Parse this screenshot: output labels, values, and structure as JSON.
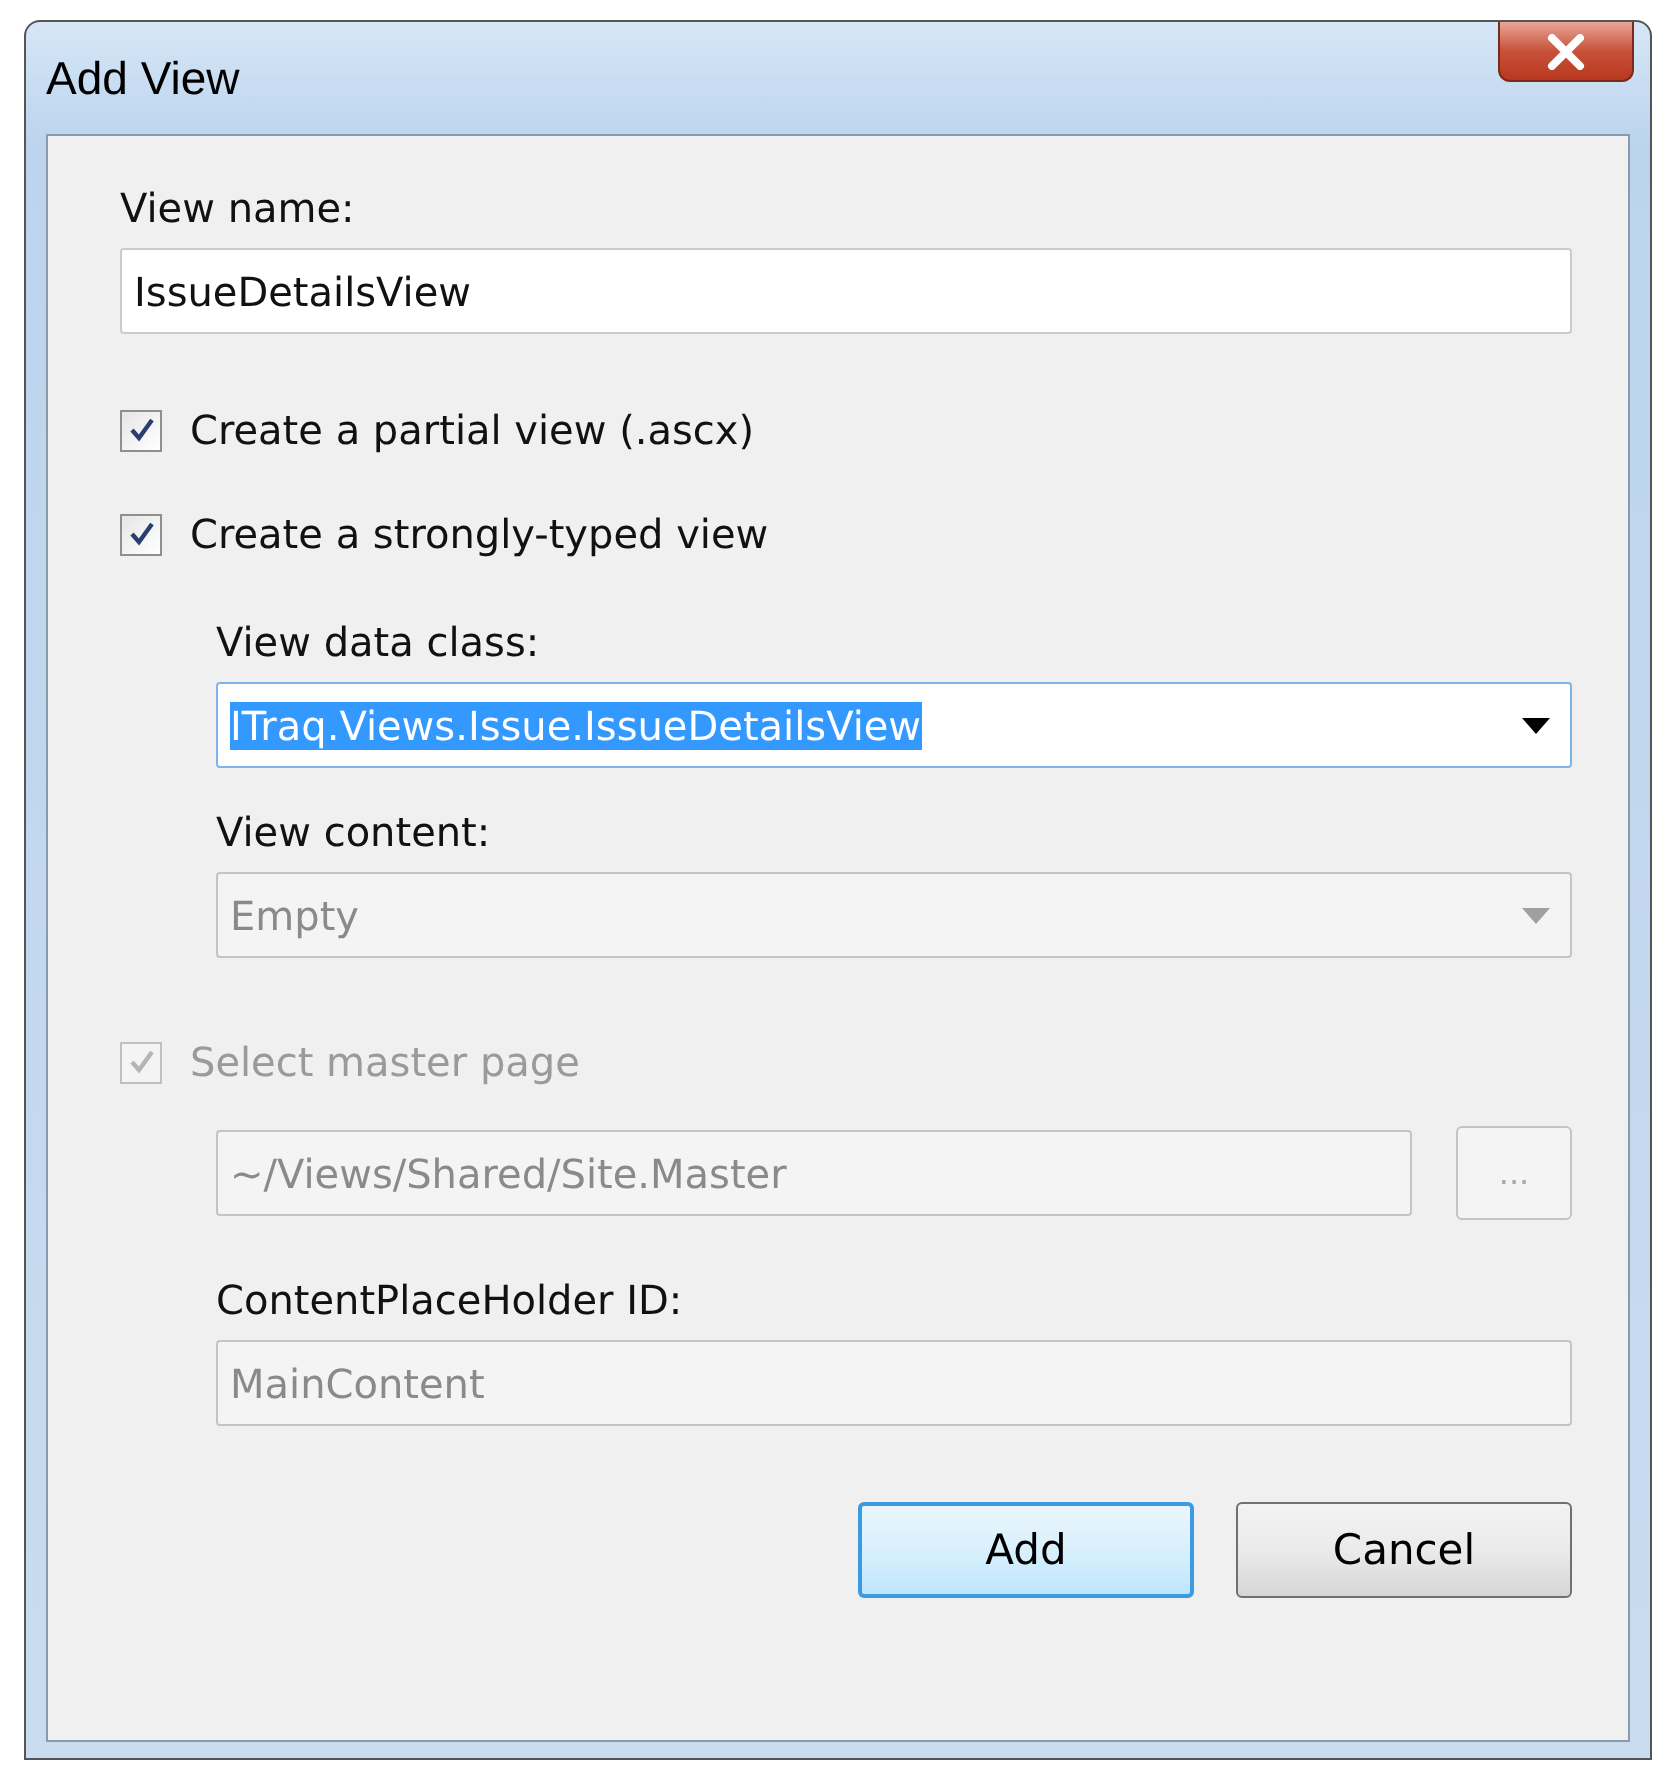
{
  "window": {
    "title": "Add View"
  },
  "view_name": {
    "label": "View name:",
    "value": "IssueDetailsView"
  },
  "partial_view": {
    "label": "Create a partial view (.ascx)",
    "checked": true,
    "disabled": false
  },
  "strongly_typed": {
    "label": "Create a strongly-typed view",
    "checked": true,
    "disabled": false
  },
  "view_data_class": {
    "label": "View data class:",
    "value": "ITraq.Views.Issue.IssueDetailsView",
    "text_selected": true,
    "disabled": false
  },
  "view_content": {
    "label": "View content:",
    "value": "Empty",
    "disabled": true
  },
  "master_page": {
    "label": "Select master page",
    "checked": true,
    "disabled": true
  },
  "master_path": {
    "value": "~/Views/Shared/Site.Master",
    "disabled": true
  },
  "browse_button": {
    "label": "...",
    "disabled": true
  },
  "content_placeholder": {
    "label": "ContentPlaceHolder ID:",
    "value": "MainContent",
    "disabled": true
  },
  "buttons": [
    {
      "label": "Add",
      "default": true
    },
    {
      "label": "Cancel",
      "default": false
    }
  ]
}
